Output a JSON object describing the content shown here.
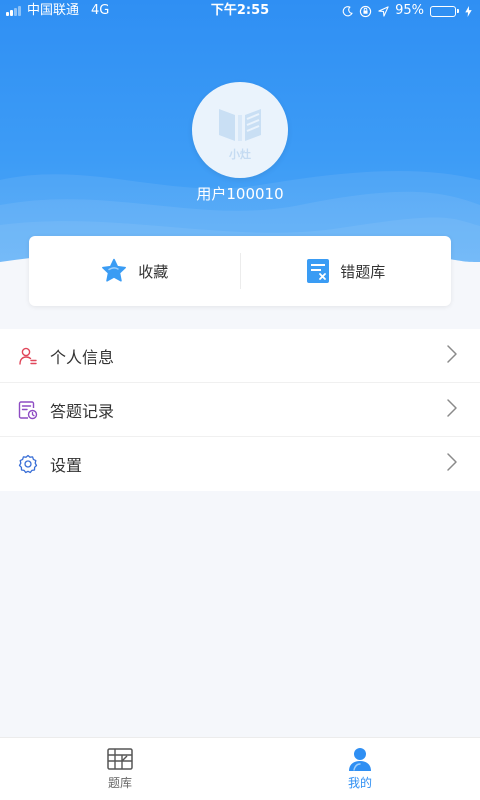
{
  "status_bar": {
    "carrier": "中国联通",
    "network": "4G",
    "time": "下午2:55",
    "battery_percent": "95%",
    "battery_level": 0.95
  },
  "profile": {
    "avatar_text": "小灶",
    "username": "用户100010"
  },
  "quick_actions": [
    {
      "label": "收藏",
      "icon": "star-icon"
    },
    {
      "label": "错题库",
      "icon": "wrong-questions-icon"
    }
  ],
  "menu": [
    {
      "label": "个人信息",
      "icon": "person-info-icon"
    },
    {
      "label": "答题记录",
      "icon": "answer-record-icon"
    },
    {
      "label": "设置",
      "icon": "gear-icon"
    }
  ],
  "tabbar": {
    "tabs": [
      {
        "label": "题库",
        "icon": "question-bank-icon",
        "active": false
      },
      {
        "label": "我的",
        "icon": "user-icon",
        "active": true
      }
    ]
  },
  "colors": {
    "primary": "#2f8ff3",
    "battery": "#4cd964",
    "star": "#3a9cf4"
  }
}
